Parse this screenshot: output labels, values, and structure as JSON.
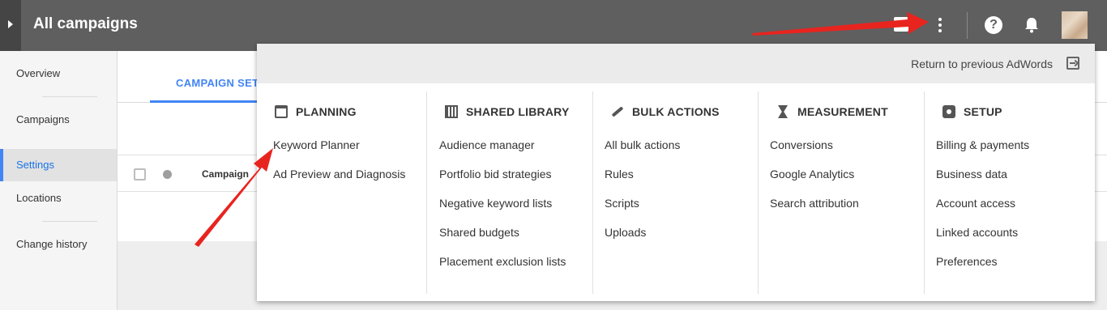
{
  "header": {
    "title": "All campaigns",
    "icons": [
      "expand-icon",
      "reports-icon",
      "more-vert-icon",
      "help-icon",
      "bell-icon",
      "avatar"
    ]
  },
  "sidebar": {
    "items": [
      {
        "label": "Overview"
      },
      {
        "label": "Campaigns"
      },
      {
        "label": "Settings",
        "active": true
      },
      {
        "label": "Locations"
      },
      {
        "label": "Change history"
      }
    ]
  },
  "content": {
    "tab_label": "CAMPAIGN SET",
    "column_campaign": "Campaign"
  },
  "menu": {
    "return_label": "Return to previous AdWords",
    "columns": [
      {
        "title": "PLANNING",
        "icon": "calendar-icon",
        "items": [
          "Keyword Planner",
          "Ad Preview and Diagnosis"
        ]
      },
      {
        "title": "SHARED LIBRARY",
        "icon": "library-icon",
        "items": [
          "Audience manager",
          "Portfolio bid strategies",
          "Negative keyword lists",
          "Shared budgets",
          "Placement exclusion lists"
        ]
      },
      {
        "title": "BULK ACTIONS",
        "icon": "wrench-icon",
        "items": [
          "All bulk actions",
          "Rules",
          "Scripts",
          "Uploads"
        ]
      },
      {
        "title": "MEASUREMENT",
        "icon": "hourglass-icon",
        "items": [
          "Conversions",
          "Google Analytics",
          "Search attribution"
        ]
      },
      {
        "title": "SETUP",
        "icon": "gear-icon",
        "items": [
          "Billing & payments",
          "Business data",
          "Account access",
          "Linked accounts",
          "Preferences"
        ]
      }
    ]
  },
  "annotations": {
    "arrow_color": "#e8241f"
  }
}
